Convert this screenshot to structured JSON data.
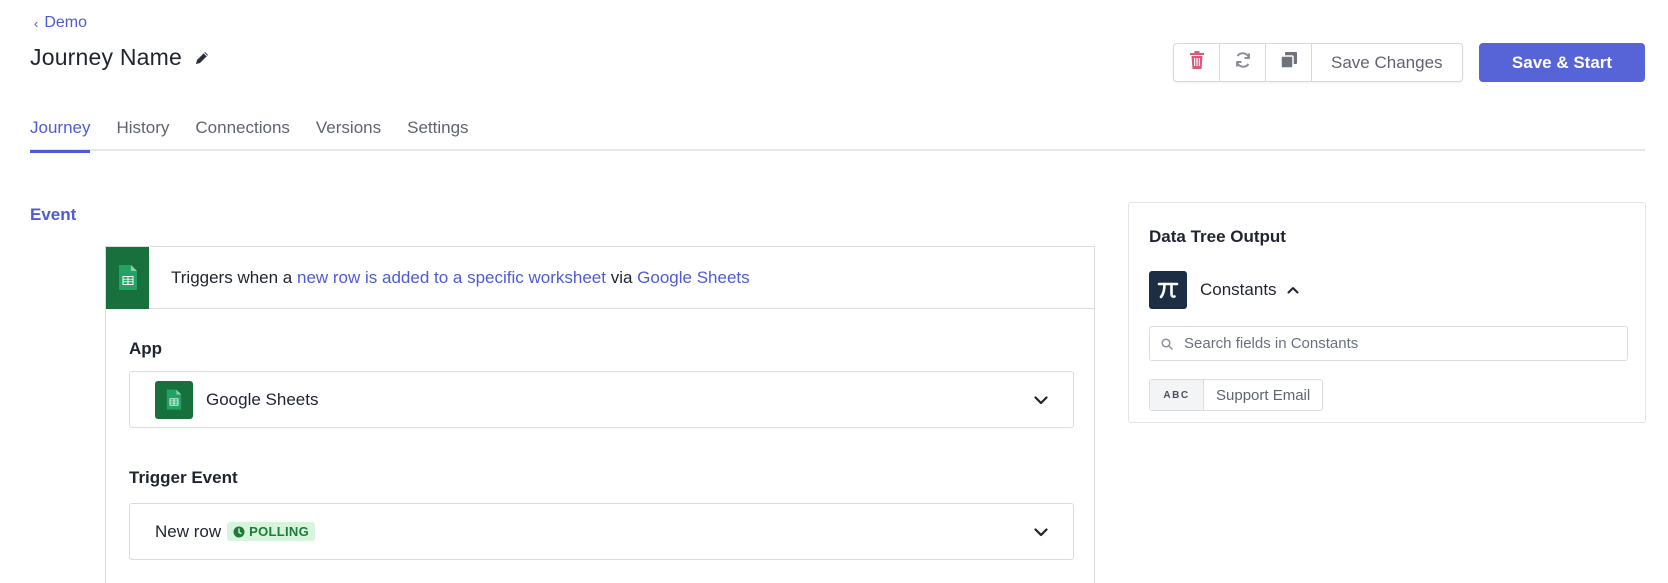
{
  "breadcrumb": {
    "label": "Demo"
  },
  "header": {
    "title": "Journey Name",
    "save_changes_label": "Save Changes",
    "save_start_label": "Save & Start",
    "icons": [
      "trash-icon",
      "refresh-icon",
      "duplicate-icon",
      "pencil-icon"
    ]
  },
  "tabs": [
    {
      "label": "Journey",
      "active": true
    },
    {
      "label": "History",
      "active": false
    },
    {
      "label": "Connections",
      "active": false
    },
    {
      "label": "Versions",
      "active": false
    },
    {
      "label": "Settings",
      "active": false
    }
  ],
  "event": {
    "section_label": "Event",
    "trigger": {
      "prefix": "Triggers when a ",
      "link1": "new row is added to a specific worksheet",
      "middle": " via ",
      "link2": "Google Sheets"
    },
    "app_label": "App",
    "app_value": "Google Sheets",
    "trigger_event_label": "Trigger Event",
    "trigger_event_value": "New row",
    "trigger_event_badge": "POLLING"
  },
  "data_tree": {
    "title": "Data Tree Output",
    "group_label": "Constants",
    "search_placeholder": "Search fields in Constants",
    "fields": [
      {
        "type": "ABC",
        "label": "Support Email"
      }
    ]
  },
  "colors": {
    "accent": "#5764d8",
    "link": "#4f5bd5",
    "sheets_green": "#18703c",
    "badge_bg": "#d6f5dc",
    "badge_text": "#1f7a3a",
    "trash_red": "#e0567a",
    "constants_navy": "#1d2d44"
  }
}
